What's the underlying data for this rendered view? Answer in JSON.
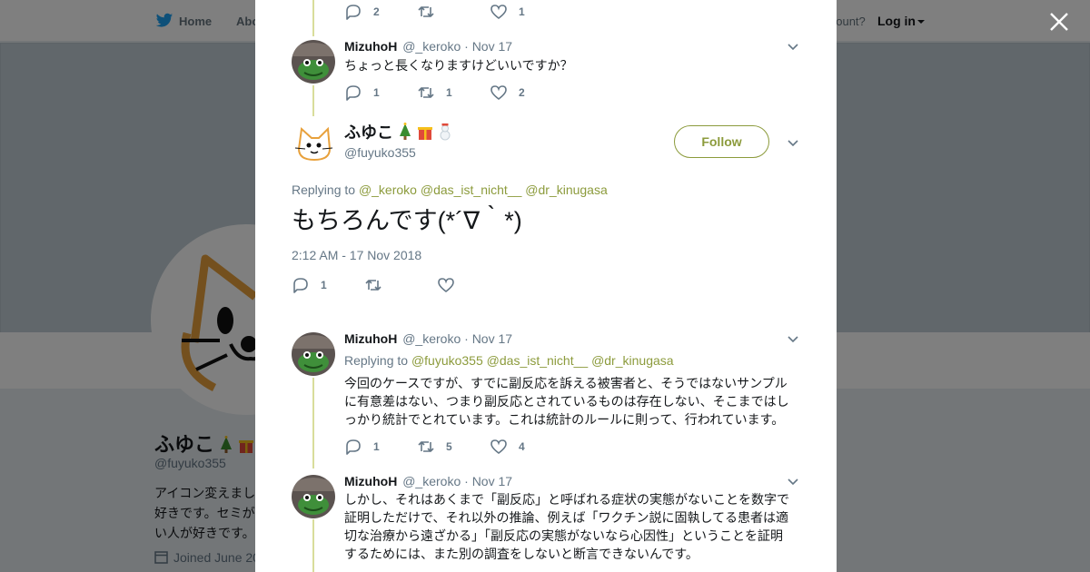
{
  "background": {
    "nav": {
      "home_label": "Home",
      "about_label": "Abo",
      "account_text": "account?",
      "login_label": "Log in"
    },
    "profile": {
      "name": "ふゆこ",
      "handle": "@fuyuko355",
      "bio_lines": [
        "アイコン変えまし",
        "好きです。セミが",
        "い人が好きです。"
      ],
      "joined": "Joined June 20"
    }
  },
  "modal": {
    "top_actions": {
      "reply_count": "2",
      "retweet_count": "",
      "like_count": "1"
    },
    "tweet1": {
      "name": "MizuhoH",
      "handle": "@_keroko",
      "date": "· Nov 17",
      "text": "ちょっと長くなりますけどいいですか？",
      "reply_count": "1",
      "retweet_count": "1",
      "like_count": "2"
    },
    "focus": {
      "name": "ふゆこ",
      "handle": "@fuyuko355",
      "follow_label": "Follow",
      "replying_label": "Replying to",
      "replying_users": [
        "@_keroko",
        "@das_ist_nicht__",
        "@dr_kinugasa"
      ],
      "text": "もちろんです(*´∇｀*)",
      "timestamp": "2:12 AM - 17 Nov 2018",
      "reply_count": "1",
      "retweet_count": "",
      "like_count": ""
    },
    "tweet2": {
      "name": "MizuhoH",
      "handle": "@_keroko",
      "date": "· Nov 17",
      "replying_label": "Replying to",
      "replying_users": [
        "@fuyuko355",
        "@das_ist_nicht__",
        "@dr_kinugasa"
      ],
      "text_lines": [
        "今回のケースですが、すでに副反応を訴える被害者と、そうではないサンプル",
        "に有意差はない、つまり副反応とされているものは存在しない、そこまではし",
        "っかり統計でとれています。これは統計のルールに則って、行われています。"
      ],
      "reply_count": "1",
      "retweet_count": "5",
      "like_count": "4"
    },
    "tweet3": {
      "name": "MizuhoH",
      "handle": "@_keroko",
      "date": "· Nov 17",
      "text_lines": [
        "しかし、それはあくまで「副反応」と呼ばれる症状の実態がないことを数字で",
        "証明しただけで、それ以外の推論、例えば「ワクチン説に固執してる患者は適",
        "切な治療から遠ざかる」「副反応の実態がないなら心因性」ということを証明",
        "するためには、また別の調査をしないと断言できないんです。"
      ]
    }
  },
  "colors": {
    "accent": "#8c9b3c",
    "thread_line": "#d9dd9b",
    "secondary_text": "#657786",
    "overlay": "rgba(0,0,0,0.5)"
  },
  "icons": [
    "twitter-bird-icon",
    "reply-icon",
    "retweet-icon",
    "like-icon",
    "chevron-down-icon",
    "close-icon",
    "calendar-icon",
    "christmas-tree-emoji",
    "gift-emoji",
    "snowman-emoji"
  ]
}
